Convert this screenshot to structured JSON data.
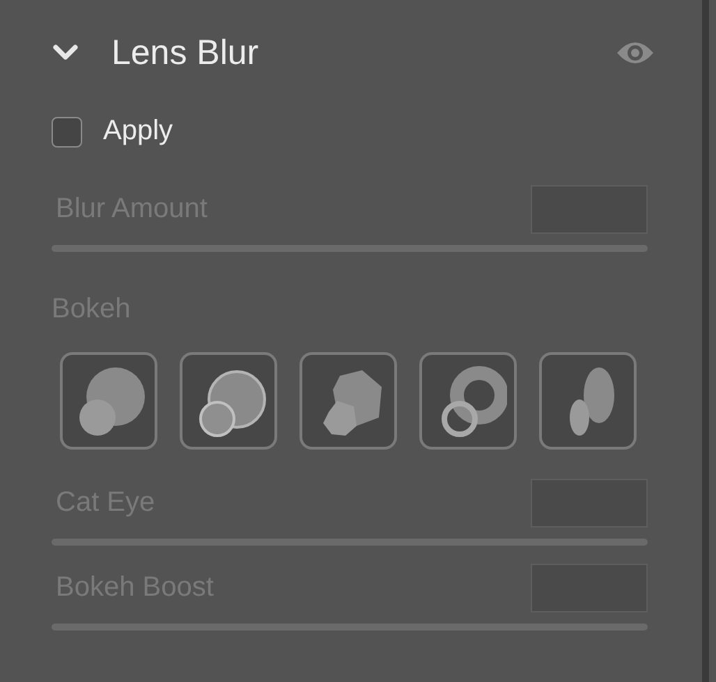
{
  "panel": {
    "title": "Lens Blur",
    "expanded": true
  },
  "apply": {
    "label": "Apply",
    "checked": false
  },
  "sliders_top": [
    {
      "label": "Blur Amount",
      "disabled": true
    }
  ],
  "bokeh": {
    "label": "Bokeh",
    "disabled": true,
    "shapes": [
      {
        "kind": "circle",
        "selected": false
      },
      {
        "kind": "bubble",
        "selected": false
      },
      {
        "kind": "blade",
        "selected": false
      },
      {
        "kind": "ring",
        "selected": false
      },
      {
        "kind": "cateye",
        "selected": false
      }
    ]
  },
  "sliders_bottom": [
    {
      "label": "Cat Eye",
      "disabled": true
    },
    {
      "label": "Bokeh Boost",
      "disabled": true
    }
  ]
}
